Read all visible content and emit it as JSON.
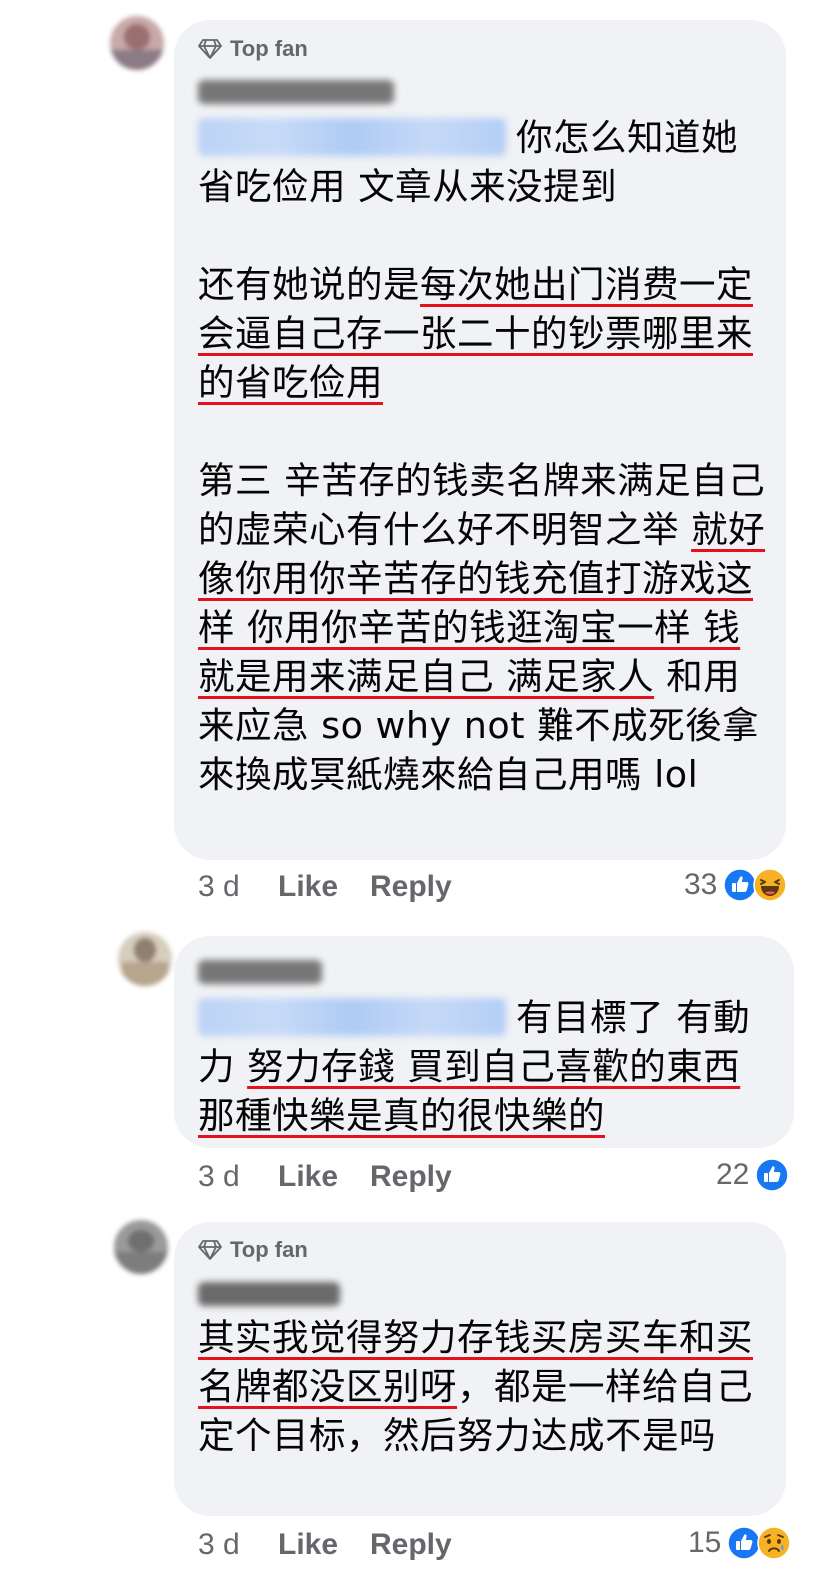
{
  "colors": {
    "bubble": "#f0f2f5",
    "underline": "#e4131b",
    "meta": "#65676b",
    "like_blue": "#1877f2",
    "haha_yellow": "#f7b125"
  },
  "comments": [
    {
      "badge": "Top fan",
      "badge_icon": "diamond-icon",
      "author_redacted": true,
      "mention_redacted": true,
      "text_segments": [
        {
          "text": "你怎么知道她省吃俭用 文章从来没提到\n\n还有她说的是",
          "underlined": false
        },
        {
          "text": "每次她出门消费一定会逼自己存一张二十的钞票哪里来的省吃俭用",
          "underlined": true
        },
        {
          "text": "\n\n第三 辛苦存的钱卖名牌来满足自己的虚荣心有什么好不明智之举 ",
          "underlined": false
        },
        {
          "text": "就好像你用你辛苦存的钱充值打游戏这样 你用你辛苦的钱逛淘宝一样 钱就是用来满足自己 满足家人",
          "underlined": true
        },
        {
          "text": " 和用来应急 so why not 難不成死後拿來換成冥紙燒來給自己用嗎 lol",
          "underlined": false
        }
      ],
      "time": "3 d",
      "like_label": "Like",
      "reply_label": "Reply",
      "reaction_count": "33",
      "reactions": [
        "like-icon",
        "haha-icon"
      ]
    },
    {
      "badge": "",
      "author_redacted": true,
      "mention_redacted": true,
      "text_segments": [
        {
          "text": "有目標了 有動力 ",
          "underlined": false
        },
        {
          "text": "努力存錢 買到自己喜歡的東西 那種快樂是真的很快樂的",
          "underlined": true
        }
      ],
      "time": "3 d",
      "like_label": "Like",
      "reply_label": "Reply",
      "reaction_count": "22",
      "reactions": [
        "like-icon"
      ]
    },
    {
      "badge": "Top fan",
      "badge_icon": "diamond-icon",
      "author_redacted": true,
      "mention_redacted": false,
      "text_segments": [
        {
          "text": "其实我觉得努力存钱买房买车和买名牌都没区别呀",
          "underlined": true
        },
        {
          "text": "，都是一样给自己定个目标，然后努力达成不是吗",
          "underlined": false
        }
      ],
      "time": "3 d",
      "like_label": "Like",
      "reply_label": "Reply",
      "reaction_count": "15",
      "reactions": [
        "like-icon",
        "sad-icon"
      ]
    }
  ]
}
